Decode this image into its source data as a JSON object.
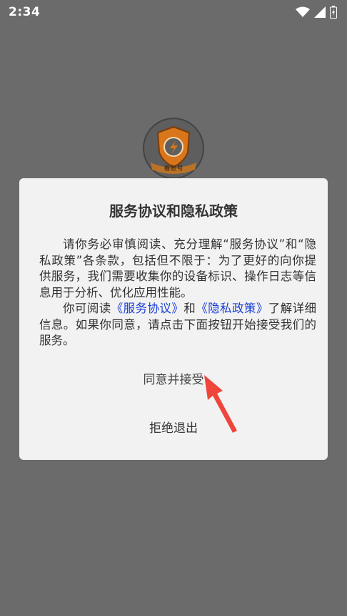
{
  "status_bar": {
    "time": "2:34",
    "icons": [
      "wifi-icon",
      "cell-signal-icon",
      "battery-icon"
    ]
  },
  "app_logo": {
    "label": "看账号",
    "icon": "shield-logo-icon",
    "colors": {
      "shield": "#e07b1a",
      "circle": "#555555",
      "ribbon": "#c9781e"
    }
  },
  "dialog": {
    "title": "服务协议和隐私政策",
    "paragraph1": "请你务必审慎阅读、充分理解“服务协议”和“隐私政策”各条款，包括但不限于：为了更好的向你提供服务，我们需要收集你的设备标识、操作日志等信息用于分析、优化应用性能。",
    "paragraph2": {
      "prefix": "你可阅读",
      "link_terms": "《服务协议》",
      "middle": "和",
      "link_privacy": "《隐私政策》",
      "suffix": "了解详细信息。如果你同意，请点击下面按钮开始接受我们的服务。"
    },
    "accept_label": "同意并接受",
    "reject_label": "拒绝退出"
  },
  "colors": {
    "overlay": "#6b6b6b",
    "dialog_bg": "#f2f2f2",
    "link": "#1a3fd6",
    "arrow": "#f0453a"
  }
}
